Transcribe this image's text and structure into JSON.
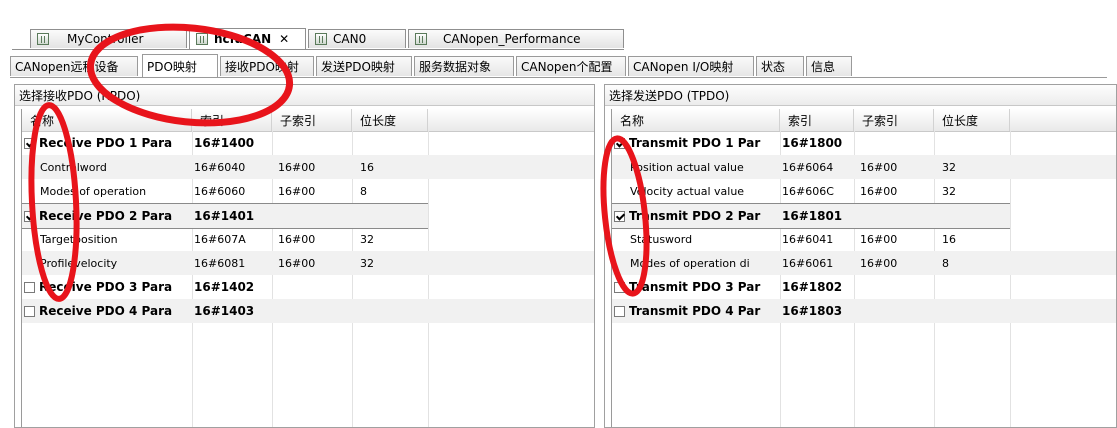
{
  "doc_tabs": [
    {
      "label": "MyController",
      "active": false
    },
    {
      "label": "hcfaCAN",
      "active": true
    },
    {
      "label": "CAN0",
      "active": false
    },
    {
      "label": "CANopen_Performance",
      "active": false
    }
  ],
  "editor_tabs": [
    "CANopen远程设备",
    "PDO映射",
    "接收PDO映射",
    "发送PDO映射",
    "服务数据对象",
    "CANopen个配置",
    "CANopen I/O映射",
    "状态",
    "信息"
  ],
  "active_editor_tab": "PDO映射",
  "columns": [
    "名称",
    "索引",
    "子索引",
    "位长度"
  ],
  "rpdo": {
    "title": "选择接收PDO (RPDO)",
    "rows": [
      {
        "type": "pdo",
        "checked": true,
        "name": "Receive PDO 1 Para",
        "index": "16#1400"
      },
      {
        "type": "obj",
        "name": "Controlword",
        "index": "16#6040",
        "subindex": "16#00",
        "bits": "16"
      },
      {
        "type": "obj",
        "name": "Modes of operation",
        "index": "16#6060",
        "subindex": "16#00",
        "bits": "8"
      },
      {
        "type": "pdo",
        "checked": true,
        "name": "Receive PDO 2 Para",
        "index": "16#1401"
      },
      {
        "type": "obj",
        "name": "Targetposition",
        "index": "16#607A",
        "subindex": "16#00",
        "bits": "32"
      },
      {
        "type": "obj",
        "name": "Profilevelocity",
        "index": "16#6081",
        "subindex": "16#00",
        "bits": "32"
      },
      {
        "type": "pdo",
        "checked": false,
        "name": "Receive PDO 3 Para",
        "index": "16#1402"
      },
      {
        "type": "pdo",
        "checked": false,
        "name": "Receive PDO 4 Para",
        "index": "16#1403"
      }
    ]
  },
  "tpdo": {
    "title": "选择发送PDO (TPDO)",
    "rows": [
      {
        "type": "pdo",
        "checked": true,
        "name": "Transmit PDO 1 Par",
        "index": "16#1800"
      },
      {
        "type": "obj",
        "name": "Position actual value",
        "index": "16#6064",
        "subindex": "16#00",
        "bits": "32"
      },
      {
        "type": "obj",
        "name": "Velocity actual value",
        "index": "16#606C",
        "subindex": "16#00",
        "bits": "32"
      },
      {
        "type": "pdo",
        "checked": true,
        "name": "Transmit PDO 2 Par",
        "index": "16#1801"
      },
      {
        "type": "obj",
        "name": "Statusword",
        "index": "16#6041",
        "subindex": "16#00",
        "bits": "16"
      },
      {
        "type": "obj",
        "name": "Modes of operation di",
        "index": "16#6061",
        "subindex": "16#00",
        "bits": "8"
      },
      {
        "type": "pdo",
        "checked": false,
        "name": "Transmit PDO 3 Par",
        "index": "16#1802"
      },
      {
        "type": "pdo",
        "checked": false,
        "name": "Transmit PDO 4 Par",
        "index": "16#1803"
      }
    ]
  },
  "colors": {
    "annotation": "#e8141b",
    "selection_border": "#8a8a8a"
  },
  "icons": {
    "device": "device-icon",
    "close": "close-icon",
    "checkbox": "checkbox"
  }
}
